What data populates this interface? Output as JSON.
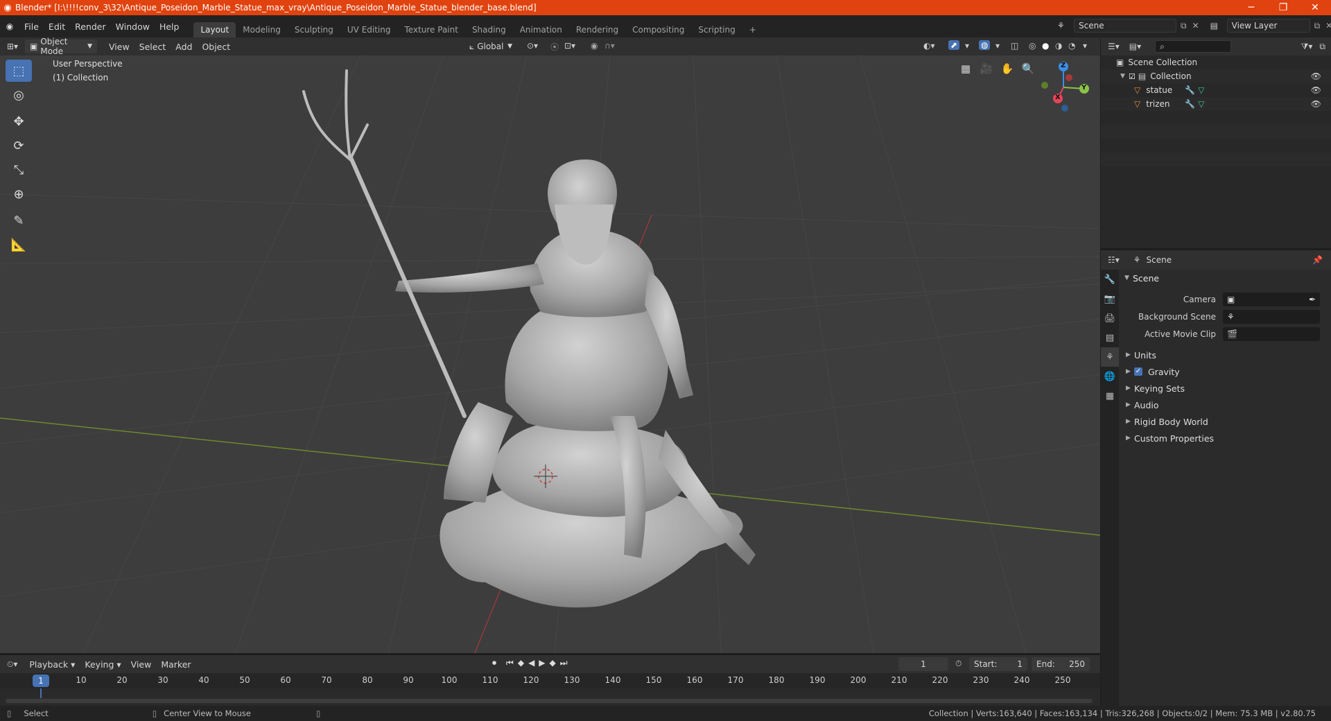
{
  "window": {
    "title": "Blender* [I:\\!!!!conv_3\\32\\Antique_Poseidon_Marble_Statue_max_vray\\Antique_Poseidon_Marble_Statue_blender_base.blend]",
    "minimize": "─",
    "restore": "❐",
    "close": "✕"
  },
  "menu": {
    "file": "File",
    "edit": "Edit",
    "render": "Render",
    "window": "Window",
    "help": "Help"
  },
  "workspaces": [
    "Layout",
    "Modeling",
    "Sculpting",
    "UV Editing",
    "Texture Paint",
    "Shading",
    "Animation",
    "Rendering",
    "Compositing",
    "Scripting"
  ],
  "workspace_add": "+",
  "scene_field": "Scene",
  "view_layer_field": "View Layer",
  "viewport_header": {
    "mode": "Object Mode",
    "view": "View",
    "select": "Select",
    "add": "Add",
    "object": "Object",
    "orientation": "Global"
  },
  "viewport": {
    "perspective": "User Perspective",
    "collection": "(1) Collection",
    "gizmo": {
      "z": "Z",
      "y": "Y",
      "x": "X"
    }
  },
  "outliner": {
    "root": "Scene Collection",
    "collection": "Collection",
    "items": [
      "statue",
      "trizen"
    ]
  },
  "properties": {
    "header": "Scene",
    "panel": "Scene",
    "camera_label": "Camera",
    "background_scene_label": "Background Scene",
    "active_movie_clip_label": "Active Movie Clip",
    "subpanels": [
      "Units",
      "Gravity",
      "Keying Sets",
      "Audio",
      "Rigid Body World",
      "Custom Properties"
    ],
    "gravity_checked": true
  },
  "timeline": {
    "playback": "Playback",
    "keying": "Keying",
    "view": "View",
    "marker": "Marker",
    "current_frame": "1",
    "start_label": "Start:",
    "start_value": "1",
    "end_label": "End:",
    "end_value": "250",
    "ticks": [
      "10",
      "20",
      "30",
      "40",
      "50",
      "60",
      "70",
      "80",
      "90",
      "100",
      "110",
      "120",
      "130",
      "140",
      "150",
      "160",
      "170",
      "180",
      "190",
      "200",
      "210",
      "220",
      "230",
      "240",
      "250"
    ],
    "playhead": "1"
  },
  "status": {
    "select": "Select",
    "center_view": "Center View to Mouse",
    "stats": "Collection | Verts:163,640 | Faces:163,134 | Tris:326,268 | Objects:0/2 | Mem: 75.3 MB | v2.80.75"
  },
  "colors": {
    "accent": "#4772b3",
    "title_bar": "#e0430f",
    "x_axis": "#e8445a",
    "y_axis": "#8bc34a",
    "z_axis": "#3d8ee6"
  }
}
